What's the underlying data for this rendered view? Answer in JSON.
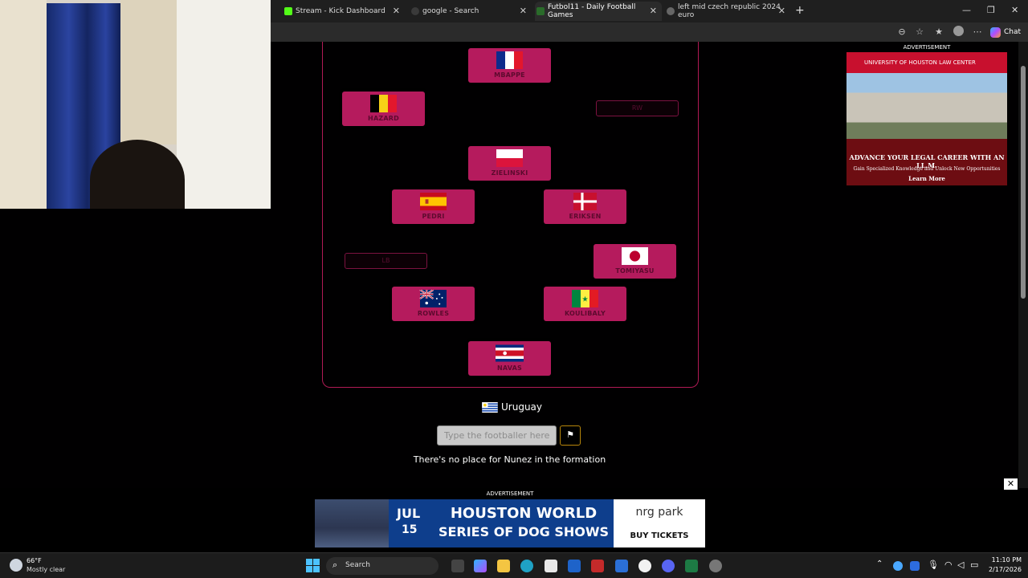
{
  "browser": {
    "tabs": [
      {
        "label": "Stream - Kick Dashboard",
        "active": false
      },
      {
        "label": "google - Search",
        "active": false
      },
      {
        "label": "Futbol11 - Daily Football Games",
        "active": true
      },
      {
        "label": "left mid czech republic 2024 euro",
        "active": false
      }
    ],
    "new_tab_icon": "plus-icon",
    "chat_label": "Chat"
  },
  "formation": {
    "filled": [
      {
        "name": "MBAPPE",
        "flag": "france"
      },
      {
        "name": "HAZARD",
        "flag": "belgium"
      },
      {
        "name": "ZIELINSKI",
        "flag": "poland"
      },
      {
        "name": "PEDRI",
        "flag": "spain"
      },
      {
        "name": "ERIKSEN",
        "flag": "denmark"
      },
      {
        "name": "TOMIYASU",
        "flag": "japan"
      },
      {
        "name": "ROWLES",
        "flag": "australia"
      },
      {
        "name": "KOULIBALY",
        "flag": "senegal"
      },
      {
        "name": "NAVAS",
        "flag": "costa-rica"
      }
    ],
    "empty": [
      {
        "position": "RW"
      },
      {
        "position": "LB"
      }
    ]
  },
  "game": {
    "nation": "Uruguay",
    "search_placeholder": "Type the footballer here",
    "message": "There's no place for Nunez in the formation"
  },
  "ads": {
    "label": "ADVERTISEMENT",
    "right": {
      "header": "UNIVERSITY OF HOUSTON LAW CENTER",
      "headline": "ADVANCE YOUR LEGAL CAREER WITH AN LL.M.",
      "subline": "Gain Specialized Knowledge and Unlock New Opportunities",
      "cta": "Learn More"
    },
    "bottom": {
      "month": "JUL",
      "day": "15",
      "headline_1": "HOUSTON WORLD",
      "headline_2": "SERIES OF DOG SHOWS",
      "brand": "nrg park",
      "cta": "BUY TICKETS"
    }
  },
  "taskbar": {
    "weather_temp": "66°F",
    "weather_desc": "Mostly clear",
    "search_label": "Search",
    "time": "11:10 PM",
    "date": "2/17/2026"
  }
}
